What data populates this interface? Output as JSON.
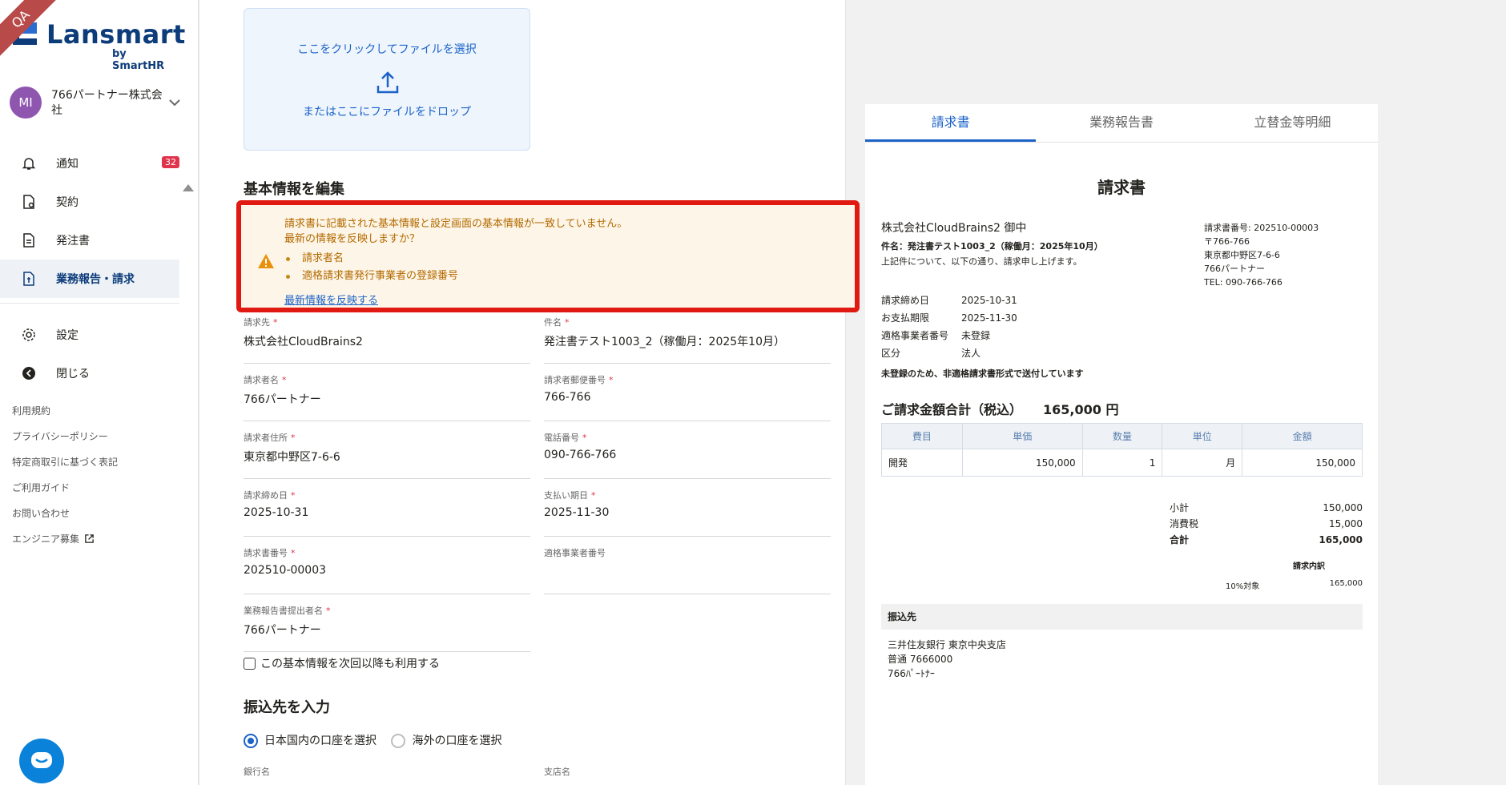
{
  "env_badge": "QA",
  "brand": {
    "name": "Lansmart",
    "by": "by SmartHR"
  },
  "account": {
    "initials": "MI",
    "name": "766パートナー株式会社"
  },
  "nav": [
    {
      "label": "通知",
      "icon": "bell-icon",
      "badge": "32"
    },
    {
      "label": "契約",
      "icon": "contract-icon"
    },
    {
      "label": "発注書",
      "icon": "document-icon"
    },
    {
      "label": "業務報告・請求",
      "icon": "invoice-icon",
      "active": true
    }
  ],
  "nav2": [
    {
      "label": "設定",
      "icon": "gear-icon"
    },
    {
      "label": "閉じる",
      "icon": "collapse-icon"
    }
  ],
  "footer_links": [
    "利用規約",
    "プライバシーポリシー",
    "特定商取引に基づく表記",
    "ご利用ガイド",
    "お問い合わせ",
    "エンジニア募集"
  ],
  "upload": {
    "line1": "ここをクリックしてファイルを選択",
    "line2": "またはここにファイルをドロップ"
  },
  "section_basic": "基本情報を編集",
  "warning": {
    "message1": "請求書に記載された基本情報と設定画面の基本情報が一致していません。",
    "message2": "最新の情報を反映しますか？",
    "items": [
      "請求者名",
      "適格請求書発行事業者の登録番号"
    ],
    "link": "最新情報を反映する"
  },
  "fields": {
    "billing_to": {
      "label": "請求先",
      "value": "株式会社CloudBrains2"
    },
    "subject": {
      "label": "件名",
      "value": "発注書テスト1003_2（稼働月：2025年10月）"
    },
    "biller_name": {
      "label": "請求者名",
      "value": "766パートナー"
    },
    "biller_zip": {
      "label": "請求者郵便番号",
      "value": "766-766"
    },
    "biller_address": {
      "label": "請求者住所",
      "value": "東京都中野区7-6-6"
    },
    "phone": {
      "label": "電話番号",
      "value": "090-766-766"
    },
    "closing_date": {
      "label": "請求締め日",
      "value": "2025-10-31"
    },
    "due_date": {
      "label": "支払い期日",
      "value": "2025-11-30"
    },
    "invoice_number": {
      "label": "請求書番号",
      "value": "202510-00003"
    },
    "qualified_number": {
      "label": "適格事業者番号",
      "value": ""
    },
    "report_submitter": {
      "label": "業務報告書提出者名",
      "value": "766パートナー"
    }
  },
  "reuse_checkbox": "この基本情報を次回以降も利用する",
  "section_bank": "振込先を入力",
  "bank_options": [
    "日本国内の口座を選択",
    "海外の口座を選択"
  ],
  "bank_labels": {
    "bank": "銀行名",
    "branch": "支店名"
  },
  "preview": {
    "tabs": [
      "請求書",
      "業務報告書",
      "立替金等明細"
    ],
    "title": "請求書",
    "to": "株式会社CloudBrains2 御中",
    "subject": "件名：発注書テスト1003_2（稼働月：2025年10月）",
    "note": "上記件について、以下の通り、請求申し上げます。",
    "right_info": [
      "請求書番号: 202510-00003",
      "〒766-766",
      "東京都中野区7-6-6",
      "766パートナー",
      "TEL: 090-766-766"
    ],
    "meta": [
      {
        "k": "請求締め日",
        "v": "2025-10-31"
      },
      {
        "k": "お支払期限",
        "v": "2025-11-30"
      },
      {
        "k": "適格事業者番号",
        "v": "未登録"
      },
      {
        "k": "区分",
        "v": "法人"
      }
    ],
    "unregistered_note": "未登録のため、非適格請求書形式で送付しています",
    "total_label": "ご請求金額合計（税込）",
    "total_value": "165,000 円",
    "table_headers": [
      "費目",
      "単価",
      "数量",
      "単位",
      "金額"
    ],
    "table_rows": [
      [
        "開発",
        "150,000",
        "1",
        "月",
        "150,000"
      ]
    ],
    "subtotal_label": "小計",
    "subtotal": "150,000",
    "tax_label": "消費税",
    "tax": "15,000",
    "grand_label": "合計",
    "grand": "165,000",
    "breakdown_title": "請求内訳",
    "breakdown_label": "10%対象",
    "breakdown_value": "165,000",
    "bank_head": "振込先",
    "bank_lines": [
      "三井住友銀行 東京中央支店",
      "普通 7666000",
      "766ﾊﾟｰﾄﾅｰ"
    ]
  }
}
